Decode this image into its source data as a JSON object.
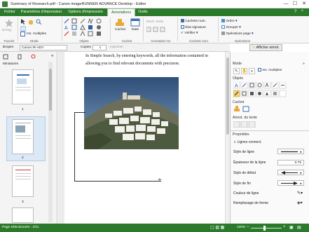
{
  "window": {
    "title": "Summary of Research.pdf - Canon imageRUNNER ADVANCE Desktop - Editor",
    "minimize": "—",
    "maximize": "☐",
    "close": "✕"
  },
  "tabs": [
    {
      "label": "Fichier"
    },
    {
      "label": "Paramètres d'impression"
    },
    {
      "label": "Options d'impression"
    },
    {
      "label": "Annotations"
    },
    {
      "label": "Outils"
    }
  ],
  "ribbon": {
    "favorites_group": "Favoris",
    "mode_group": "Mode",
    "objects_group": "Objets",
    "stamp_group": "Cachet",
    "text_annot_group": "Annotation txt",
    "stamp_num_group": "Cachets num.",
    "operations_group": "Opérations",
    "enreg": "Enreg.",
    "ins_multiples": "Ins. multiples",
    "cachet": "Cachet",
    "date": "Date",
    "rech_texte": "Rech. texte",
    "cachets_num": "Cachets num.",
    "etat_signature": "État signature",
    "verifier": "Vérifier",
    "ordre": "Ordre",
    "grouper": "Grouper",
    "operations_page": "Opérations page"
  },
  "propbar": {
    "stapler_label": "Bropier",
    "printer_value": "Canon iR-ADV",
    "copies_label": "Copies",
    "copies_value": "1",
    "imprimer": "Imprimer",
    "afficher_annot": "Afficher annot."
  },
  "left_pane": {
    "miniatures_label": "Miniatures",
    "pages": [
      "1",
      "2",
      "3"
    ]
  },
  "document": {
    "line1": "In Simple Search, by entering keywords, all the information contained in",
    "line2": "allowing you to find relevant documents with precision."
  },
  "right_pane": {
    "mode_label": "Mode",
    "ins_multiples": "Ins. multiples",
    "objets_label": "Objets",
    "cachet_label": "Cachet",
    "annot_texte_label": "Annot. du texte",
    "proprietes_label": "Propriétés",
    "object_name": "Lignes connect.",
    "props": [
      {
        "label": "Style de ligne"
      },
      {
        "label": "Épaisseur de la ligne",
        "value": "0.75"
      },
      {
        "label": "Style de début"
      },
      {
        "label": "Style de fin"
      },
      {
        "label": "Couleur de ligne"
      },
      {
        "label": "Remplissage de forme"
      }
    ]
  },
  "status": {
    "page_selected": "Page sélectionnée : 2/11",
    "zoom": "100%"
  },
  "colors": {
    "accent_green": "#2b7a2b",
    "selected_blue": "#dbe8f6"
  }
}
